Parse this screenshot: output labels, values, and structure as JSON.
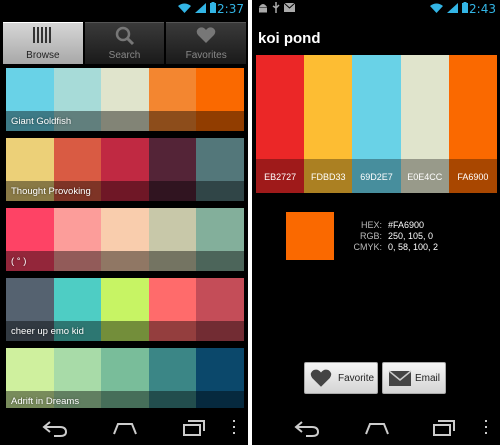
{
  "left": {
    "status": {
      "time": "12:37"
    },
    "tabs": [
      {
        "label": "Browse",
        "icon": "barcode-icon",
        "active": true
      },
      {
        "label": "Search",
        "icon": "search-icon",
        "active": false
      },
      {
        "label": "Favorites",
        "icon": "heart-icon",
        "active": false
      }
    ],
    "palettes": [
      {
        "name": "Giant Goldfish",
        "colors": [
          "#69D2E7",
          "#A7DBD8",
          "#E0E4CC",
          "#F38630",
          "#FA6900"
        ]
      },
      {
        "name": "Thought Provoking",
        "colors": [
          "#ECD078",
          "#D95B43",
          "#C02942",
          "#542437",
          "#53777A"
        ]
      },
      {
        "name": "(  ° )",
        "colors": [
          "#FE4365",
          "#FC9D9A",
          "#F9CDAD",
          "#C8C8A9",
          "#83AF9B"
        ]
      },
      {
        "name": "cheer up emo kid",
        "colors": [
          "#556270",
          "#4ECDC4",
          "#C7F464",
          "#FF6B6B",
          "#C44D58"
        ]
      },
      {
        "name": "Adrift in Dreams",
        "colors": [
          "#CFF09E",
          "#A8DBA8",
          "#79BD9A",
          "#3B8686",
          "#0B486B"
        ]
      }
    ]
  },
  "right": {
    "status": {
      "time": "12:43"
    },
    "title": "koi pond",
    "swatches": [
      {
        "hex": "EB2727",
        "color": "#EB2727"
      },
      {
        "hex": "FDBD33",
        "color": "#FDBD33"
      },
      {
        "hex": "69D2E7",
        "color": "#69D2E7"
      },
      {
        "hex": "E0E4CC",
        "color": "#E0E4CC"
      },
      {
        "hex": "FA6900",
        "color": "#FA6900"
      }
    ],
    "selected": {
      "color": "#FA6900",
      "hex_label": "HEX:",
      "hex_value": "#FA6900",
      "rgb_label": "RGB:",
      "rgb_value": "250, 105, 0",
      "cmyk_label": "CMYK:",
      "cmyk_value": "0, 58, 100, 2"
    },
    "buttons": {
      "favorite_label": "Favorite",
      "email_label": "Email"
    }
  },
  "colors": {
    "status_accent": "#33b5e5"
  }
}
